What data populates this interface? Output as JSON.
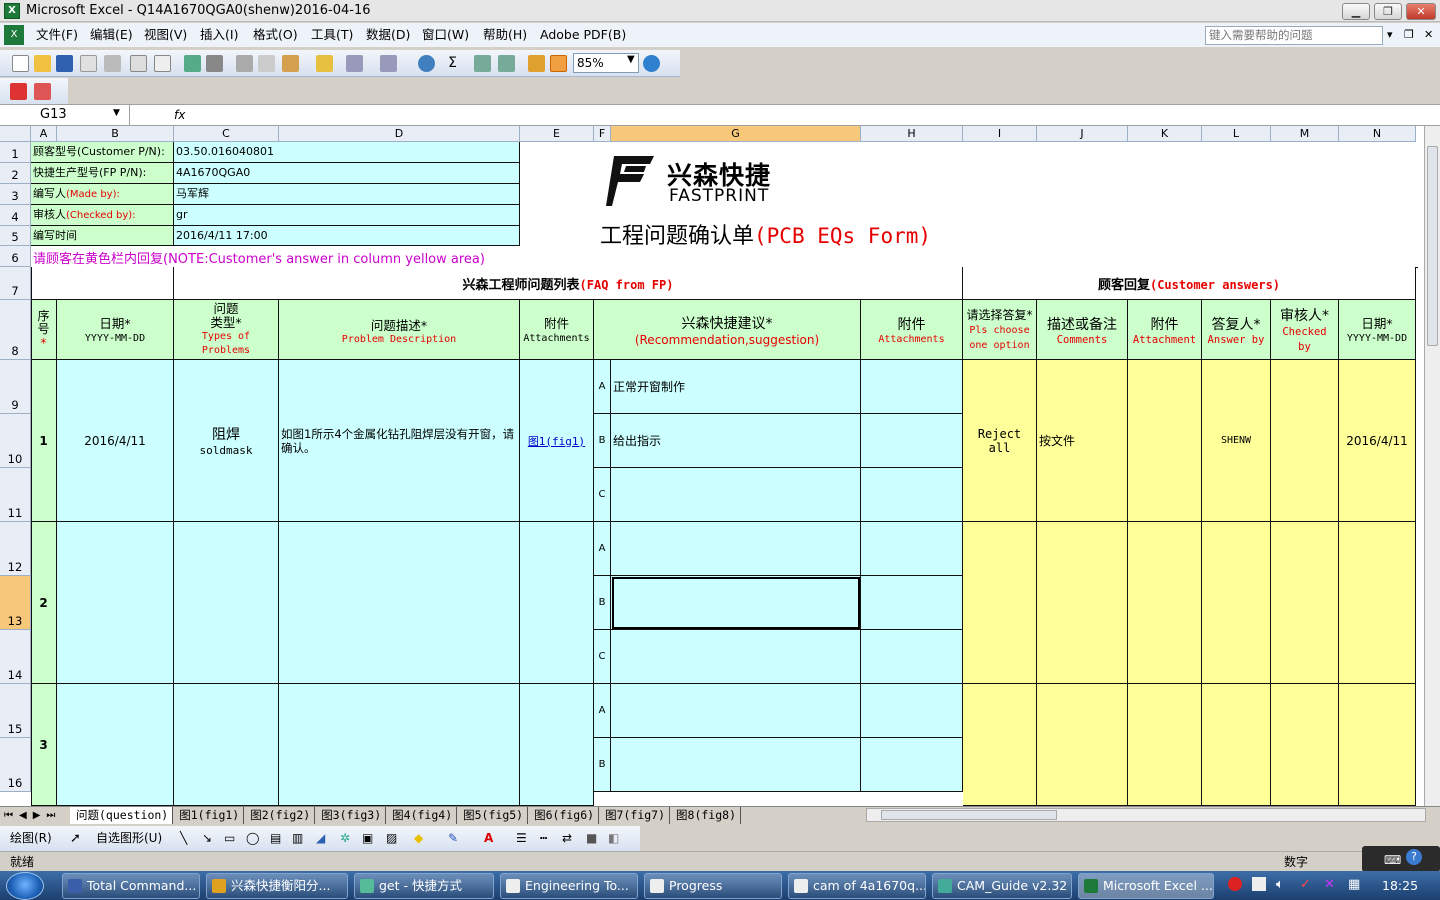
{
  "window": {
    "title": "Microsoft Excel - Q14A1670QGA0(shenw)2016-04-16"
  },
  "menu": [
    "文件(F)",
    "编辑(E)",
    "视图(V)",
    "插入(I)",
    "格式(O)",
    "工具(T)",
    "数据(D)",
    "窗口(W)",
    "帮助(H)",
    "Adobe PDF(B)"
  ],
  "help_placeholder": "键入需要帮助的问题",
  "zoom": "85%",
  "name_box": "G13",
  "fx": "fx",
  "columns": [
    "A",
    "B",
    "C",
    "D",
    "E",
    "F",
    "G",
    "H",
    "I",
    "J",
    "K",
    "L",
    "M",
    "N"
  ],
  "rows": [
    "1",
    "2",
    "3",
    "4",
    "5",
    "6",
    "7",
    "8",
    "9",
    "10",
    "11",
    "12",
    "13",
    "14",
    "15",
    "16"
  ],
  "header_info": {
    "customer_pn_label": "顾客型号(Customer P/N):",
    "customer_pn_value": "03.50.016040801",
    "fp_pn_label": "快捷生产型号(FP P/N):",
    "fp_pn_value": "4A1670QGA0",
    "made_by_label_cn": "编写人",
    "made_by_label_en": "(Made by):",
    "made_by_value": "马军辉",
    "checked_by_label_cn": "审核人",
    "checked_by_label_en": "(Checked by):",
    "checked_by_value": "gr",
    "time_label": "编写时间",
    "time_value": "2016/4/11 17:00"
  },
  "logo": {
    "cn": "兴森快捷",
    "en": "FASTPRINT"
  },
  "form_title": {
    "cn": "工程问题确认单",
    "en": "(PCB EQs Form)"
  },
  "note": {
    "cn": "请顾客在黄色栏内回复",
    "en": "(NOTE:Customer's answer in column yellow area)"
  },
  "section_fp": {
    "cn": "兴森工程师问题列表",
    "en": "(FAQ from FP)"
  },
  "section_customer": {
    "cn": "顾客回复",
    "en": "(Customer answers)"
  },
  "table_headers": {
    "seq": "序号",
    "date_cn": "日期*",
    "date_en": "YYYY-MM-DD",
    "type_cn1": "问题",
    "type_cn2": "类型*",
    "type_en": "Types of Problems",
    "desc_cn": "问题描述*",
    "desc_en": "Problem Description",
    "attach_cn": "附件",
    "attach_en": "Attachments",
    "sugg_cn": "兴森快捷建议*",
    "sugg_en": "(Recommendation,suggestion)",
    "attach2_cn": "附件",
    "attach2_en": "Attachments",
    "choose_cn": "请选择答复*",
    "choose_en": "Pls choose one option",
    "comments_cn": "描述或备注",
    "comments_en": "Comments",
    "attach3_cn": "附件",
    "attach3_en": "Attachment",
    "answer_cn": "答复人*",
    "answer_en": "Answer by",
    "checker_cn": "审核人*",
    "checker_en": "Checked by",
    "date2_cn": "日期*",
    "date2_en": "YYYY-MM-DD"
  },
  "questions": [
    {
      "no": "1",
      "date": "2016/4/11",
      "type_cn": "阻焊",
      "type_en": "soldmask",
      "desc": "如图1所示4个金属化钻孔阻焊层没有开窗，请确认。",
      "attach": "图1(fig1)",
      "options": [
        {
          "k": "A",
          "v": "正常开窗制作"
        },
        {
          "k": "B",
          "v": "给出指示"
        },
        {
          "k": "C",
          "v": ""
        }
      ],
      "choice": "Reject all",
      "comment": "按文件",
      "answer_by": "SHENW",
      "checked_by": "",
      "reply_date": "2016/4/11"
    },
    {
      "no": "2",
      "date": "",
      "type_cn": "",
      "type_en": "",
      "desc": "",
      "attach": "",
      "options": [
        {
          "k": "A",
          "v": ""
        },
        {
          "k": "B",
          "v": ""
        },
        {
          "k": "C",
          "v": ""
        }
      ],
      "choice": "",
      "comment": "",
      "answer_by": "",
      "checked_by": "",
      "reply_date": ""
    },
    {
      "no": "3",
      "date": "",
      "type_cn": "",
      "type_en": "",
      "desc": "",
      "attach": "",
      "options": [
        {
          "k": "A",
          "v": ""
        },
        {
          "k": "B",
          "v": ""
        }
      ],
      "choice": "",
      "comment": "",
      "answer_by": "",
      "checked_by": "",
      "reply_date": ""
    }
  ],
  "sheet_tabs": [
    "问题(question)",
    "图1(fig1)",
    "图2(fig2)",
    "图3(fig3)",
    "图4(fig4)",
    "图5(fig5)",
    "图6(fig6)",
    "图7(fig7)",
    "图8(fig8)"
  ],
  "drawing_toolbar": {
    "draw": "绘图(R)",
    "autoshape": "自选图形(U)"
  },
  "status": {
    "ready": "就绪",
    "num": "数字"
  },
  "taskbar": {
    "items": [
      "Total Command...",
      "兴森快捷衡阳分...",
      "get - 快捷方式",
      "Engineering To...",
      "Progress",
      "cam of 4a1670q...",
      "CAM_Guide v2.32",
      "Microsoft Excel ..."
    ],
    "clock": "18:25"
  }
}
